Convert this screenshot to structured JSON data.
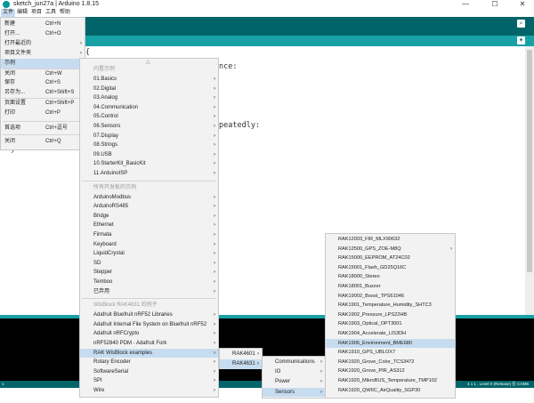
{
  "window": {
    "title": "sketch_jun27a | Arduino 1.8.15",
    "minimize_label": "—",
    "maximize_label": "☐",
    "close_label": "✕"
  },
  "menubar": {
    "items": [
      "文件",
      "编辑",
      "项目",
      "工具",
      "帮助"
    ]
  },
  "editor": {
    "lines": [
      "{",
      "nce:",
      "peatedly:",
      "}"
    ]
  },
  "footer": {
    "left_text": "1",
    "status_text": "4 1 1 , Level 0 (Release) 在 COM6"
  },
  "file_menu": {
    "items": [
      {
        "label": "新建",
        "shortcut": "Ctrl+N",
        "submenu": false,
        "highlight": false
      },
      {
        "label": "打开...",
        "shortcut": "Ctrl+O",
        "submenu": false,
        "highlight": false
      },
      {
        "label": "打开最近的",
        "shortcut": "",
        "submenu": true,
        "highlight": false
      },
      {
        "label": "项目文件夹",
        "shortcut": "",
        "submenu": true,
        "highlight": false
      },
      {
        "label": "示例",
        "shortcut": "",
        "submenu": true,
        "highlight": true
      },
      {
        "label": "关闭",
        "shortcut": "Ctrl+W",
        "submenu": false,
        "highlight": false
      },
      {
        "label": "保存",
        "shortcut": "Ctrl+S",
        "submenu": false,
        "highlight": false
      },
      {
        "label": "另存为...",
        "shortcut": "Ctrl+Shift+S",
        "submenu": false,
        "highlight": false
      },
      {
        "label": "页面设置",
        "shortcut": "Ctrl+Shift+P",
        "submenu": false,
        "highlight": false
      },
      {
        "label": "打印",
        "shortcut": "Ctrl+P",
        "submenu": false,
        "highlight": false
      },
      {
        "label": "首选项",
        "shortcut": "Ctrl+逗号",
        "submenu": false,
        "highlight": false
      },
      {
        "label": "关闭",
        "shortcut": "Ctrl+Q",
        "submenu": false,
        "highlight": false
      }
    ]
  },
  "examples_menu": {
    "scroll_up": "△",
    "builtin_header": "内置示例",
    "builtin": [
      "01.Basics",
      "02.Digital",
      "03.Analog",
      "04.Communication",
      "05.Control",
      "06.Sensors",
      "07.Display",
      "08.Strings",
      "09.USB",
      "10.StarterKit_BasicKit",
      "11.ArduinoISP"
    ],
    "all_boards_header": "所有开发板的示例",
    "all_boards": [
      "ArduinoModbus",
      "ArduinoRS485",
      "Bridge",
      "Ethernet",
      "Firmata",
      "Keyboard",
      "LiquidCrystal",
      "SD",
      "Stepper",
      "Temboo",
      "已弃用"
    ],
    "board_header": "WisBlock RAK4631 的例子",
    "board": [
      "Adafruit Bluefruit nRF52 Libraries",
      "Adafruit Internal File System on Bluefruit nRF52",
      "Adafruit nRFCrypto",
      "nRF52840 PDM - Adafruit Fork",
      "RAK WisBlock examples",
      "Rotary Encoder",
      "SoftwareSerial",
      "SPI",
      "Wire"
    ],
    "highlight": "RAK WisBlock examples"
  },
  "rak_menu": {
    "items": [
      "RAK4601",
      "RAK4631"
    ],
    "highlight": "RAK4631"
  },
  "rak4631_menu": {
    "items": [
      "Communications",
      "IO",
      "Power",
      "Sensors"
    ],
    "highlight": "Sensors"
  },
  "sensors_menu": {
    "items": [
      "RAK12003_FIR_MLX90632",
      "RAK12500_GPS_ZOE-M8Q",
      "RAK15000_EEPROM_AT24C02",
      "RAK15001_Flash_GD25Q16C",
      "RAK18000_Stereo",
      "RAK18001_Buzzer",
      "RAK19002_Boost_TPS61046",
      "RAK1901_Temperature_Humidity_SHTC3",
      "RAK1902_Pressure_LPS22HB",
      "RAK1903_Optical_OPT3001",
      "RAK1904_Accelerate_LIS3DH",
      "RAK1906_Environment_BME680",
      "RAK1910_GPS_UBLOX7",
      "RAK1920_Grove_Color_TCS3472",
      "RAK1920_Grove_PIR_AS312",
      "RAK1920_MikroBUS_Temperature_TMP102",
      "RAK1920_QWIIC_AirQuality_SGP30"
    ],
    "highlight": "RAK1906_Environment_BME680"
  },
  "icons": {
    "arrow": "›",
    "toolbar_search": "⌕",
    "toolbar_tab": "▾"
  },
  "colors": {
    "toolbar": "#006468",
    "tab_strip": "#17a1a5",
    "highlight": "#c6dcf0",
    "console": "#000000"
  }
}
